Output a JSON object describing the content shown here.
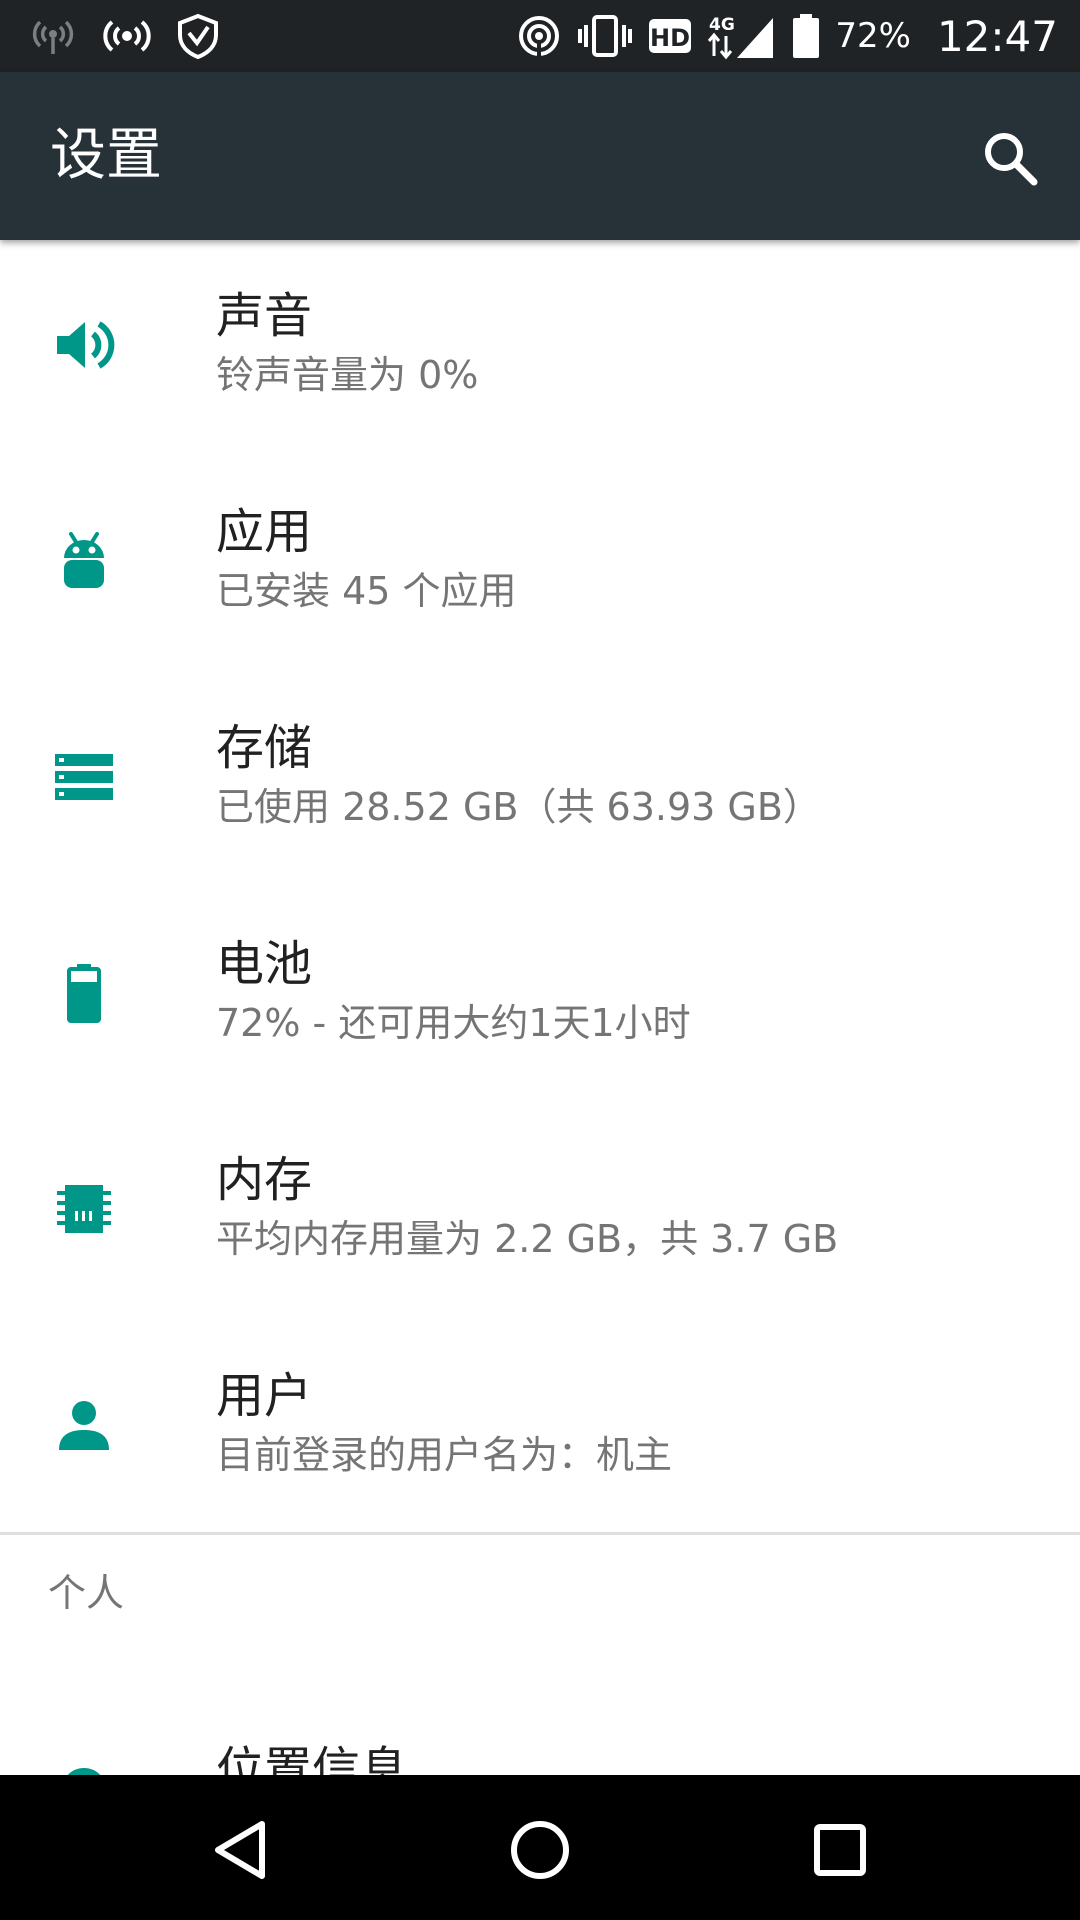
{
  "status_bar": {
    "battery_percent": "72%",
    "time": "12:47",
    "hd_label": "HD",
    "network_label": "4G"
  },
  "app_bar": {
    "title": "设置"
  },
  "settings": [
    {
      "title": "声音",
      "summary": "铃声音量为 0%",
      "icon": "volume-icon"
    },
    {
      "title": "应用",
      "summary": "已安装 45 个应用",
      "icon": "android-icon"
    },
    {
      "title": "存储",
      "summary": "已使用 28.52 GB（共 63.93 GB）",
      "icon": "storage-icon"
    },
    {
      "title": "电池",
      "summary": "72% - 还可用大约1天1小时",
      "icon": "battery-icon"
    },
    {
      "title": "内存",
      "summary": "平均内存用量为 2.2 GB，共 3.7 GB",
      "icon": "memory-icon"
    },
    {
      "title": "用户",
      "summary": "目前登录的用户名为：机主",
      "icon": "person-icon"
    }
  ],
  "section_personal": {
    "header": "个人",
    "items": [
      {
        "title": "位置信息",
        "icon": "location-icon"
      }
    ]
  },
  "colors": {
    "accent": "#009688",
    "app_bar": "#263238",
    "status_bar": "#1f2326",
    "title_text": "#212121",
    "summary_text": "#757575"
  }
}
